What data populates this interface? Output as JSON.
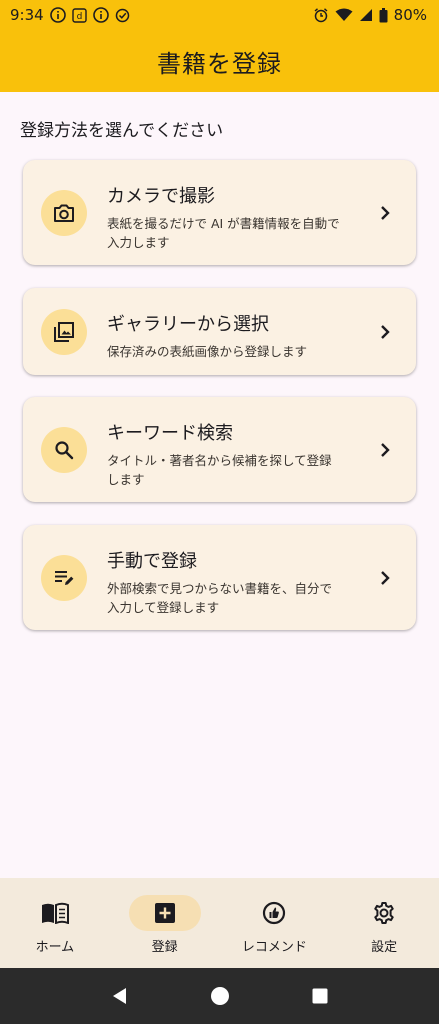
{
  "status_bar": {
    "time": "9:34",
    "battery": "80%"
  },
  "app_bar": {
    "title": "書籍を登録"
  },
  "main": {
    "instruction": "登録方法を選んでください",
    "options": [
      {
        "title": "カメラで撮影",
        "desc_line1": "表紙を撮るだけで AI が書籍情報を自動で",
        "desc_line2": "入力します",
        "icon": "camera-icon"
      },
      {
        "title": "ギャラリーから選択",
        "desc_line1": "保存済みの表紙画像から登録します",
        "desc_line2": "",
        "icon": "gallery-icon"
      },
      {
        "title": "キーワード検索",
        "desc_line1": "タイトル・著者名から候補を探して登録",
        "desc_line2": "します",
        "icon": "search-icon"
      },
      {
        "title": "手動で登録",
        "desc_line1": "外部検索で見つからない書籍を、自分で",
        "desc_line2": "入力して登録します",
        "icon": "edit-note-icon"
      }
    ]
  },
  "bottom_nav": {
    "items": [
      {
        "label": "ホーム",
        "icon": "book-icon",
        "active": false
      },
      {
        "label": "登録",
        "icon": "add-box-icon",
        "active": true
      },
      {
        "label": "レコメンド",
        "icon": "recommend-icon",
        "active": false
      },
      {
        "label": "設定",
        "icon": "gear-icon",
        "active": false
      }
    ]
  },
  "colors": {
    "primary": "#f9c10b",
    "card_bg": "#fbf1e3",
    "icon_circle": "#fbdf97",
    "nav_bg": "#f3eadc",
    "nav_active": "#f6dfb3",
    "page_bg": "#fdf6fb"
  }
}
